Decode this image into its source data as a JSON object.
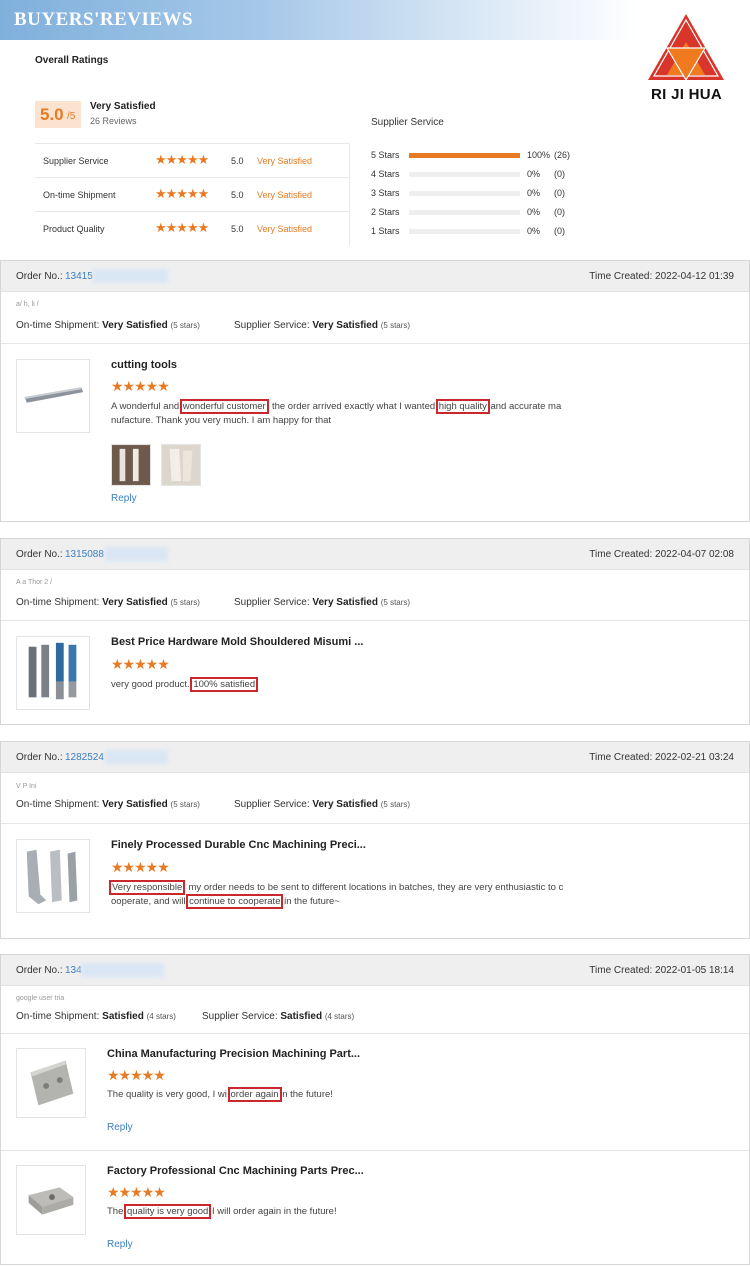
{
  "banner": {
    "title": "BUYERS'REVIEWS"
  },
  "logo": {
    "text": "RI JI HUA"
  },
  "overall": {
    "title": "Overall Ratings",
    "score": "5.0",
    "score_max": "/5",
    "label": "Very Satisfied",
    "count": "26 Reviews",
    "rows": [
      {
        "name": "Supplier Service",
        "stars": "★★★★★",
        "score": "5.0",
        "label": "Very Satisfied"
      },
      {
        "name": "On-time Shipment",
        "stars": "★★★★★",
        "score": "5.0",
        "label": "Very Satisfied"
      },
      {
        "name": "Product Quality",
        "stars": "★★★★★",
        "score": "5.0",
        "label": "Very Satisfied"
      }
    ]
  },
  "supplier_service": {
    "title": "Supplier Service",
    "bars": [
      {
        "label": "5 Stars",
        "fraction": 1.0,
        "pct": "100%",
        "count": "(26)"
      },
      {
        "label": "4 Stars",
        "fraction": 0,
        "pct": "0%",
        "count": "(0)"
      },
      {
        "label": "3 Stars",
        "fraction": 0,
        "pct": "0%",
        "count": "(0)"
      },
      {
        "label": "2 Stars",
        "fraction": 0,
        "pct": "0%",
        "count": "(0)"
      },
      {
        "label": "1 Stars",
        "fraction": 0,
        "pct": "0%",
        "count": "(0)"
      }
    ]
  },
  "colors": {
    "accent": "#e87a23",
    "link": "#3a7ec2",
    "highlight": "#c9282d"
  },
  "orders": [
    {
      "order_label": "Order No.:",
      "order_no": "13415",
      "time": "Time Created: 2022-04-12 01:39",
      "buyer": "a/   h,   li /",
      "shipment_label": "On-time Shipment:",
      "shipment_value": "Very Satisfied",
      "shipment_stars": "(5 stars)",
      "service_label": "Supplier Service:",
      "service_value": "Very Satisfied",
      "service_stars": "(5 stars)",
      "product_title": "cutting tools",
      "stars": "★★★★★",
      "review_parts": [
        "A wonderful and ",
        "wonderful customer",
        ", the order arrived exactly what I wanted ",
        "high quality",
        " and accurate ma nufacture. Thank you very much. I am happy for that"
      ],
      "reply": "Reply"
    },
    {
      "order_label": "Order No.:",
      "order_no": "1315088",
      "time": "Time Created: 2022-04-07 02:08",
      "buyer": "A   a   Thor   2   /",
      "shipment_label": "On-time Shipment:",
      "shipment_value": "Very Satisfied",
      "shipment_stars": "(5 stars)",
      "service_label": "Supplier Service:",
      "service_value": "Very Satisfied",
      "service_stars": "(5 stars)",
      "product_title": "Best Price Hardware Mold Shouldered Misumi ...",
      "stars": "★★★★★",
      "review_parts": [
        "very good product. ",
        "100% satisfied"
      ]
    },
    {
      "order_label": "Order No.:",
      "order_no": "1282524",
      "time": "Time Created: 2022-02-21 03:24",
      "buyer": "V   P   Ini",
      "shipment_label": "On-time Shipment:",
      "shipment_value": "Very Satisfied",
      "shipment_stars": "(5 stars)",
      "service_label": "Supplier Service:",
      "service_value": "Very Satisfied",
      "service_stars": "(5 stars)",
      "product_title": "Finely Processed Durable Cnc Machining Preci...",
      "stars": "★★★★★",
      "review_parts": [
        "Very responsible",
        ", my order needs to be sent to different locations in batches, they are very enthusiastic to c ooperate, and will ",
        "continue to cooperate",
        " in the future~"
      ]
    },
    {
      "order_label": "Order No.:",
      "order_no": "134",
      "time": "Time Created: 2022-01-05 18:14",
      "buyer": "google user   tria",
      "shipment_label": "On-time Shipment:",
      "shipment_value": "Satisfied",
      "shipment_stars": "(4 stars)",
      "service_label": "Supplier Service:",
      "service_value": "Satisfied",
      "service_stars": "(4 stars)",
      "products": [
        {
          "title": "China Manufacturing Precision Machining Part...",
          "stars": "★★★★★",
          "review_parts": [
            "The quality is very good, I wi ",
            "order again",
            " n the future!"
          ],
          "reply": "Reply"
        },
        {
          "title": "Factory Professional Cnc Machining Parts Prec...",
          "stars": "★★★★★",
          "review_parts": [
            "The ",
            "quality is very good",
            " I will order again in the future!"
          ],
          "reply": "Reply"
        }
      ]
    }
  ]
}
